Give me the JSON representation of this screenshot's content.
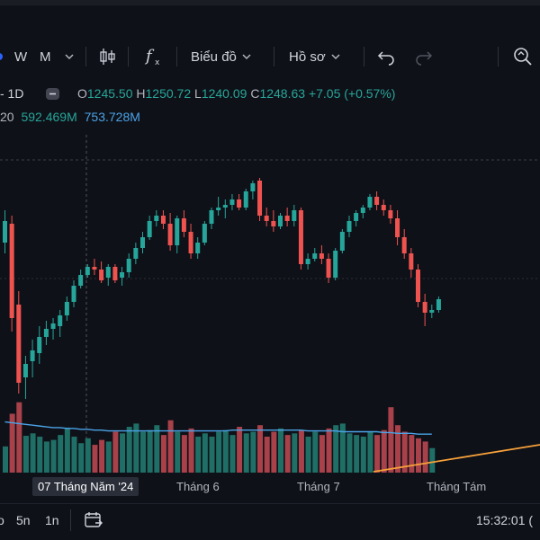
{
  "toolbar": {
    "interval_w": "W",
    "interval_m": "M",
    "chart_type_label": "Biểu đồ",
    "profile_label": "Hồ sơ"
  },
  "legend": {
    "interval": "- 1D",
    "o_label": "O",
    "o_value": "1245.50",
    "h_label": "H",
    "h_value": "1250.72",
    "l_label": "L",
    "l_value": "1240.09",
    "c_label": "C",
    "c_value": "1248.63",
    "change": "+7.05 (+0.57%)",
    "vol_prefix": "20",
    "vol_value1": "592.469M",
    "vol_value2": "753.728M"
  },
  "time_axis": {
    "crosshair_date": "07 Tháng Năm '24",
    "june": "Tháng 6",
    "july": "Tháng 7",
    "august": "Tháng Tám"
  },
  "bottom": {
    "range_5d": "5n",
    "range_1d": "1n",
    "clock": "15:32:01 ("
  },
  "colors": {
    "up": "#26a69a",
    "down": "#ef5350",
    "up_volume": "#1f6f66",
    "down_volume": "#a8414a",
    "volume_ma": "#4aa3e8",
    "trend_line": "#f7a13a"
  },
  "chart_data": {
    "type": "candlestick",
    "y_range": [
      1168,
      1268
    ],
    "candles": [
      {
        "o": 1228,
        "h": 1240,
        "l": 1224,
        "c": 1236
      },
      {
        "o": 1235,
        "h": 1238,
        "l": 1195,
        "c": 1200
      },
      {
        "o": 1205,
        "h": 1210,
        "l": 1172,
        "c": 1176
      },
      {
        "o": 1178,
        "h": 1186,
        "l": 1170,
        "c": 1183
      },
      {
        "o": 1184,
        "h": 1192,
        "l": 1178,
        "c": 1188
      },
      {
        "o": 1187,
        "h": 1197,
        "l": 1183,
        "c": 1193
      },
      {
        "o": 1193,
        "h": 1199,
        "l": 1190,
        "c": 1196
      },
      {
        "o": 1196,
        "h": 1200,
        "l": 1192,
        "c": 1198
      },
      {
        "o": 1197,
        "h": 1203,
        "l": 1193,
        "c": 1201
      },
      {
        "o": 1201,
        "h": 1208,
        "l": 1199,
        "c": 1206
      },
      {
        "o": 1206,
        "h": 1214,
        "l": 1204,
        "c": 1212
      },
      {
        "o": 1212,
        "h": 1218,
        "l": 1211,
        "c": 1216
      },
      {
        "o": 1216,
        "h": 1220,
        "l": 1215,
        "c": 1219
      },
      {
        "o": 1219,
        "h": 1222,
        "l": 1216,
        "c": 1218
      },
      {
        "o": 1218,
        "h": 1221,
        "l": 1213,
        "c": 1214
      },
      {
        "o": 1215,
        "h": 1220,
        "l": 1212,
        "c": 1219
      },
      {
        "o": 1219,
        "h": 1220,
        "l": 1213,
        "c": 1214
      },
      {
        "o": 1215,
        "h": 1219,
        "l": 1212,
        "c": 1217
      },
      {
        "o": 1217,
        "h": 1224,
        "l": 1215,
        "c": 1222
      },
      {
        "o": 1222,
        "h": 1228,
        "l": 1220,
        "c": 1226
      },
      {
        "o": 1226,
        "h": 1232,
        "l": 1224,
        "c": 1230
      },
      {
        "o": 1230,
        "h": 1238,
        "l": 1229,
        "c": 1236
      },
      {
        "o": 1236,
        "h": 1240,
        "l": 1234,
        "c": 1238
      },
      {
        "o": 1238,
        "h": 1240,
        "l": 1233,
        "c": 1235
      },
      {
        "o": 1235,
        "h": 1239,
        "l": 1225,
        "c": 1227
      },
      {
        "o": 1227,
        "h": 1238,
        "l": 1224,
        "c": 1237
      },
      {
        "o": 1237,
        "h": 1240,
        "l": 1230,
        "c": 1232
      },
      {
        "o": 1232,
        "h": 1235,
        "l": 1222,
        "c": 1224
      },
      {
        "o": 1224,
        "h": 1230,
        "l": 1222,
        "c": 1228
      },
      {
        "o": 1228,
        "h": 1236,
        "l": 1227,
        "c": 1235
      },
      {
        "o": 1235,
        "h": 1241,
        "l": 1233,
        "c": 1240
      },
      {
        "o": 1240,
        "h": 1245,
        "l": 1238,
        "c": 1241
      },
      {
        "o": 1241,
        "h": 1244,
        "l": 1237,
        "c": 1242
      },
      {
        "o": 1242,
        "h": 1246,
        "l": 1240,
        "c": 1244
      },
      {
        "o": 1244,
        "h": 1246,
        "l": 1240,
        "c": 1241
      },
      {
        "o": 1241,
        "h": 1248,
        "l": 1240,
        "c": 1247
      },
      {
        "o": 1247,
        "h": 1251,
        "l": 1244,
        "c": 1250
      },
      {
        "o": 1251,
        "h": 1252,
        "l": 1236,
        "c": 1238
      },
      {
        "o": 1238,
        "h": 1241,
        "l": 1234,
        "c": 1236
      },
      {
        "o": 1236,
        "h": 1240,
        "l": 1232,
        "c": 1234
      },
      {
        "o": 1234,
        "h": 1239,
        "l": 1233,
        "c": 1238
      },
      {
        "o": 1238,
        "h": 1241,
        "l": 1234,
        "c": 1236
      },
      {
        "o": 1236,
        "h": 1242,
        "l": 1234,
        "c": 1240
      },
      {
        "o": 1240,
        "h": 1241,
        "l": 1218,
        "c": 1220
      },
      {
        "o": 1220,
        "h": 1224,
        "l": 1218,
        "c": 1222
      },
      {
        "o": 1222,
        "h": 1226,
        "l": 1221,
        "c": 1224
      },
      {
        "o": 1224,
        "h": 1227,
        "l": 1220,
        "c": 1222
      },
      {
        "o": 1222,
        "h": 1224,
        "l": 1213,
        "c": 1215
      },
      {
        "o": 1215,
        "h": 1226,
        "l": 1214,
        "c": 1225
      },
      {
        "o": 1225,
        "h": 1233,
        "l": 1224,
        "c": 1232
      },
      {
        "o": 1232,
        "h": 1238,
        "l": 1230,
        "c": 1236
      },
      {
        "o": 1236,
        "h": 1240,
        "l": 1234,
        "c": 1239
      },
      {
        "o": 1239,
        "h": 1242,
        "l": 1237,
        "c": 1241
      },
      {
        "o": 1241,
        "h": 1246,
        "l": 1240,
        "c": 1245
      },
      {
        "o": 1245,
        "h": 1247,
        "l": 1240,
        "c": 1242
      },
      {
        "o": 1242,
        "h": 1244,
        "l": 1238,
        "c": 1240
      },
      {
        "o": 1240,
        "h": 1242,
        "l": 1235,
        "c": 1237
      },
      {
        "o": 1237,
        "h": 1240,
        "l": 1227,
        "c": 1230
      },
      {
        "o": 1230,
        "h": 1233,
        "l": 1222,
        "c": 1224
      },
      {
        "o": 1224,
        "h": 1226,
        "l": 1215,
        "c": 1218
      },
      {
        "o": 1218,
        "h": 1220,
        "l": 1204,
        "c": 1206
      },
      {
        "o": 1206,
        "h": 1209,
        "l": 1197,
        "c": 1202
      },
      {
        "o": 1202,
        "h": 1205,
        "l": 1200,
        "c": 1203
      },
      {
        "o": 1203,
        "h": 1208,
        "l": 1202,
        "c": 1207
      }
    ],
    "volume_range": [
      0,
      100
    ],
    "volume": [
      32,
      72,
      86,
      45,
      48,
      44,
      38,
      40,
      46,
      55,
      44,
      36,
      42,
      34,
      40,
      38,
      50,
      48,
      56,
      60,
      50,
      52,
      58,
      46,
      64,
      50,
      46,
      54,
      44,
      48,
      44,
      50,
      52,
      46,
      56,
      48,
      50,
      58,
      44,
      50,
      54,
      46,
      48,
      52,
      44,
      50,
      46,
      54,
      58,
      60,
      48,
      46,
      44,
      50,
      46,
      52,
      80,
      58,
      50,
      46,
      42,
      38,
      30
    ],
    "volume_ma": [
      62,
      61,
      60,
      59,
      58,
      57,
      56,
      55,
      55,
      54,
      54,
      53,
      53,
      52,
      52,
      51,
      51,
      51,
      51,
      51,
      51,
      51,
      51,
      51,
      51,
      51,
      51,
      51,
      51,
      51,
      51,
      51,
      51,
      52,
      52,
      52,
      52,
      52,
      52,
      52,
      52,
      52,
      52,
      52,
      51,
      51,
      51,
      51,
      51,
      50,
      50,
      50,
      50,
      50,
      50,
      49,
      49,
      48,
      48,
      48,
      47,
      47,
      47
    ]
  }
}
